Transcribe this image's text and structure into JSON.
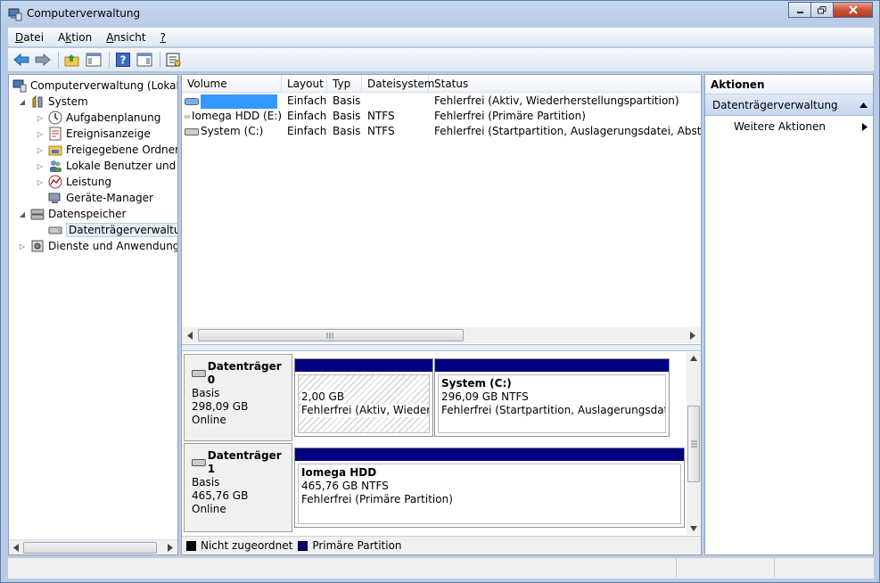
{
  "window": {
    "title": "Computerverwaltung"
  },
  "menu": [
    {
      "label": "Datei",
      "accel": "D"
    },
    {
      "label": "Aktion",
      "accel": "k"
    },
    {
      "label": "Ansicht",
      "accel": "A"
    },
    {
      "label": "?",
      "accel": "?"
    }
  ],
  "tree": {
    "items": [
      {
        "label": "Computerverwaltung (Lokal)",
        "level": 0,
        "expander": "",
        "icon": "computer-management-icon"
      },
      {
        "label": "System",
        "level": 1,
        "expander": "expanded",
        "icon": "system-tools-icon"
      },
      {
        "label": "Aufgabenplanung",
        "level": 2,
        "expander": "collapsed",
        "icon": "task-scheduler-icon"
      },
      {
        "label": "Ereignisanzeige",
        "level": 2,
        "expander": "collapsed",
        "icon": "event-viewer-icon"
      },
      {
        "label": "Freigegebene Ordner",
        "level": 2,
        "expander": "collapsed",
        "icon": "shared-folders-icon"
      },
      {
        "label": "Lokale Benutzer und Gruppen",
        "level": 2,
        "expander": "collapsed",
        "icon": "users-icon"
      },
      {
        "label": "Leistung",
        "level": 2,
        "expander": "collapsed",
        "icon": "performance-icon"
      },
      {
        "label": "Geräte-Manager",
        "level": 2,
        "expander": "",
        "icon": "device-manager-icon"
      },
      {
        "label": "Datenspeicher",
        "level": 1,
        "expander": "expanded",
        "icon": "storage-icon"
      },
      {
        "label": "Datenträgerverwaltung",
        "level": 2,
        "expander": "",
        "icon": "disk-management-icon",
        "selected": true
      },
      {
        "label": "Dienste und Anwendungen",
        "level": 1,
        "expander": "collapsed",
        "icon": "services-icon"
      }
    ]
  },
  "volumes": {
    "columns": [
      "Volume",
      "Layout",
      "Typ",
      "Dateisystem",
      "Status"
    ],
    "rows": [
      {
        "volume": "",
        "layout": "Einfach",
        "type": "Basis",
        "fs": "",
        "status": "Fehlerfrei (Aktiv, Wiederherstellungspartition)"
      },
      {
        "volume": "Iomega HDD (E:)",
        "layout": "Einfach",
        "type": "Basis",
        "fs": "NTFS",
        "status": "Fehlerfrei (Primäre Partition)"
      },
      {
        "volume": "System (C:)",
        "layout": "Einfach",
        "type": "Basis",
        "fs": "NTFS",
        "status": "Fehlerfrei (Startpartition, Auslagerungsdatei, Absturzabbild, Primäre Partition)"
      }
    ]
  },
  "disks": [
    {
      "name": "Datenträger 0",
      "type": "Basis",
      "size": "298,09 GB",
      "state": "Online",
      "partitions": [
        {
          "title": "",
          "size": "2,00 GB",
          "status": "Fehlerfrei (Aktiv, Wiederherstellungspartition)"
        },
        {
          "title": "System  (C:)",
          "size": "296,09 GB NTFS",
          "status": "Fehlerfrei (Startpartition, Auslagerungsdatei, Absturzabbild)"
        }
      ]
    },
    {
      "name": "Datenträger 1",
      "type": "Basis",
      "size": "465,76 GB",
      "state": "Online",
      "partitions": [
        {
          "title": "Iomega HDD",
          "size": "465,76 GB NTFS",
          "status": "Fehlerfrei (Primäre Partition)"
        }
      ]
    }
  ],
  "legend": [
    {
      "label": "Nicht zugeordnet",
      "color": "#000000"
    },
    {
      "label": "Primäre Partition",
      "color": "#000080"
    }
  ],
  "actions": {
    "header": "Aktionen",
    "section": "Datenträgerverwaltung",
    "items": [
      "Weitere Aktionen"
    ]
  },
  "colors": {
    "primary_partition": "#000080",
    "selection": "#3399ff"
  }
}
